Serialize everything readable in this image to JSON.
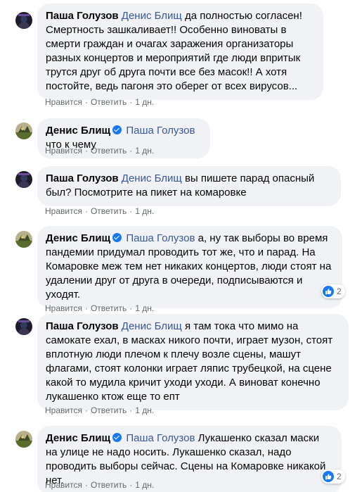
{
  "comments": [
    {
      "author": "Паша Голузов",
      "verified": false,
      "mention": "Денис Блищ",
      "text": " да полностью согласен! Смертность зашкаливает!! Особенно виноваты в смерти граждан и очагах заражения организаторы разных концертов и мероприятий где люди впритык трутся друг об друга почти все без масок!! А хотя постойте, ведь пагоня это оберег от всех вирусов...",
      "like": "Нравится",
      "reply": "Ответить",
      "time": "1 дн."
    },
    {
      "author": "Денис Блищ",
      "verified": true,
      "mention": "Паша Голузов",
      "text": " что к чему",
      "like": "Нравится",
      "reply": "Ответить",
      "time": "1 дн."
    },
    {
      "author": "Паша Голузов",
      "verified": false,
      "mention": "Денис Блищ",
      "text": " вы пишете парад опасный был? Посмотрите на пикет на комаровке",
      "like": "Нравится",
      "reply": "Ответить",
      "time": "1 дн."
    },
    {
      "author": "Денис Блищ",
      "verified": true,
      "mention": "Паша Голузов",
      "text": " а, ну так выборы во время пандемии придумал проводить тот же, что и парад. На Комаровке меж тем нет никаких концертов, люди стоят на удалении друг от друга в очереди, подписываются и уходят.",
      "like": "Нравится",
      "reply": "Ответить",
      "time": "1 дн.",
      "reactions": "2"
    },
    {
      "author": "Паша Голузов",
      "verified": false,
      "mention": "Денис Блищ",
      "text": " я там тока что мимо на самокате ехал, в масках никого почти, играет музон, стоят вплотную люди плечом к плечу возле сцены, машут флагами, стоят колонки играет ляпис трубецкой, на сцене какой то мудила кричит уходи уходи. А виноват конечно лукашенко ктож еще то епт",
      "like": "Нравится",
      "reply": "Ответить",
      "time": "1 дн."
    },
    {
      "author": "Денис Блищ",
      "verified": true,
      "mention": "Паша Голузов",
      "text": " Лукашенко сказал маски на улице не надо носить. Лукашенко сказал, надо проводить выборы сейчас. Сцены на Комаровке никакой нет.",
      "like": "Нравится",
      "reply": "Ответить",
      "time": "1 дн.",
      "reactions": "2"
    }
  ]
}
